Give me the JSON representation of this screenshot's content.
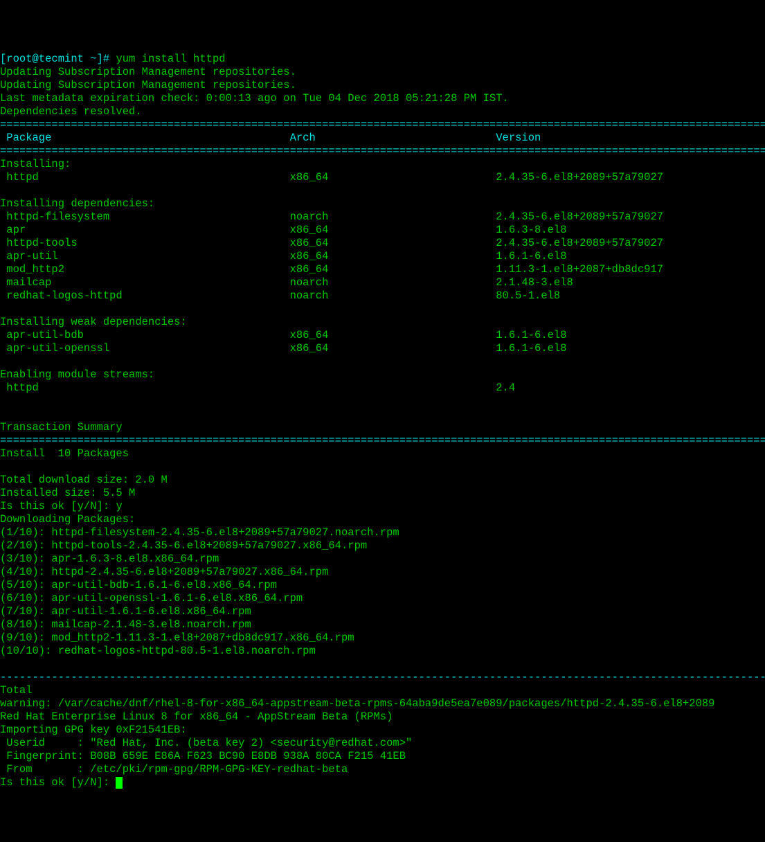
{
  "prompt_prefix": "[root@tecmint ~]# ",
  "command": "yum install httpd",
  "intro": [
    "Updating Subscription Management repositories.",
    "Updating Subscription Management repositories.",
    "Last metadata expiration check: 0:00:13 ago on Tue 04 Dec 2018 05:21:28 PM IST.",
    "Dependencies resolved."
  ],
  "headers": {
    "pkg": " Package",
    "arch": "Arch",
    "ver": "Version"
  },
  "sections": {
    "installing": "Installing:",
    "installing_dependencies": "Installing dependencies:",
    "installing_weak": "Installing weak dependencies:",
    "enabling_streams": "Enabling module streams:"
  },
  "packages": {
    "installing": [
      {
        "name": " httpd",
        "arch": "x86_64",
        "ver": "2.4.35-6.el8+2089+57a79027"
      }
    ],
    "dependencies": [
      {
        "name": " httpd-filesystem",
        "arch": "noarch",
        "ver": "2.4.35-6.el8+2089+57a79027"
      },
      {
        "name": " apr",
        "arch": "x86_64",
        "ver": "1.6.3-8.el8"
      },
      {
        "name": " httpd-tools",
        "arch": "x86_64",
        "ver": "2.4.35-6.el8+2089+57a79027"
      },
      {
        "name": " apr-util",
        "arch": "x86_64",
        "ver": "1.6.1-6.el8"
      },
      {
        "name": " mod_http2",
        "arch": "x86_64",
        "ver": "1.11.3-1.el8+2087+db8dc917"
      },
      {
        "name": " mailcap",
        "arch": "noarch",
        "ver": "2.1.48-3.el8"
      },
      {
        "name": " redhat-logos-httpd",
        "arch": "noarch",
        "ver": "80.5-1.el8"
      }
    ],
    "weak": [
      {
        "name": " apr-util-bdb",
        "arch": "x86_64",
        "ver": "1.6.1-6.el8"
      },
      {
        "name": " apr-util-openssl",
        "arch": "x86_64",
        "ver": "1.6.1-6.el8"
      }
    ],
    "streams": [
      {
        "name": " httpd",
        "arch": "",
        "ver": "2.4"
      }
    ]
  },
  "summary": {
    "title": "Transaction Summary",
    "install_line": "Install  10 Packages",
    "download_size": "Total download size: 2.0 M",
    "installed_size": "Installed size: 5.5 M"
  },
  "confirm1": {
    "prompt": "Is this ok [y/N]: ",
    "answer": "y"
  },
  "downloading_header": "Downloading Packages:",
  "downloads": [
    "(1/10): httpd-filesystem-2.4.35-6.el8+2089+57a79027.noarch.rpm",
    "(2/10): httpd-tools-2.4.35-6.el8+2089+57a79027.x86_64.rpm",
    "(3/10): apr-1.6.3-8.el8.x86_64.rpm",
    "(4/10): httpd-2.4.35-6.el8+2089+57a79027.x86_64.rpm",
    "(5/10): apr-util-bdb-1.6.1-6.el8.x86_64.rpm",
    "(6/10): apr-util-openssl-1.6.1-6.el8.x86_64.rpm",
    "(7/10): apr-util-1.6.1-6.el8.x86_64.rpm",
    "(8/10): mailcap-2.1.48-3.el8.noarch.rpm",
    "(9/10): mod_http2-1.11.3-1.el8+2087+db8dc917.x86_64.rpm",
    "(10/10): redhat-logos-httpd-80.5-1.el8.noarch.rpm"
  ],
  "total": "Total",
  "warning": "warning: /var/cache/dnf/rhel-8-for-x86_64-appstream-beta-rpms-64aba9de5ea7e089/packages/httpd-2.4.35-6.el8+2089",
  "signed": "Red Hat Enterprise Linux 8 for x86_64 - AppStream Beta (RPMs)",
  "gpg": {
    "header": "Importing GPG key 0xF21541EB:",
    "userid": " Userid     : \"Red Hat, Inc. (beta key 2) <security@redhat.com>\"",
    "finger": " Fingerprint: B08B 659E E86A F623 BC90 E8DB 938A 80CA F215 41EB",
    "from": " From       : /etc/pki/rpm-gpg/RPM-GPG-KEY-redhat-beta"
  },
  "confirm2": {
    "prompt": "Is this ok [y/N]: "
  }
}
